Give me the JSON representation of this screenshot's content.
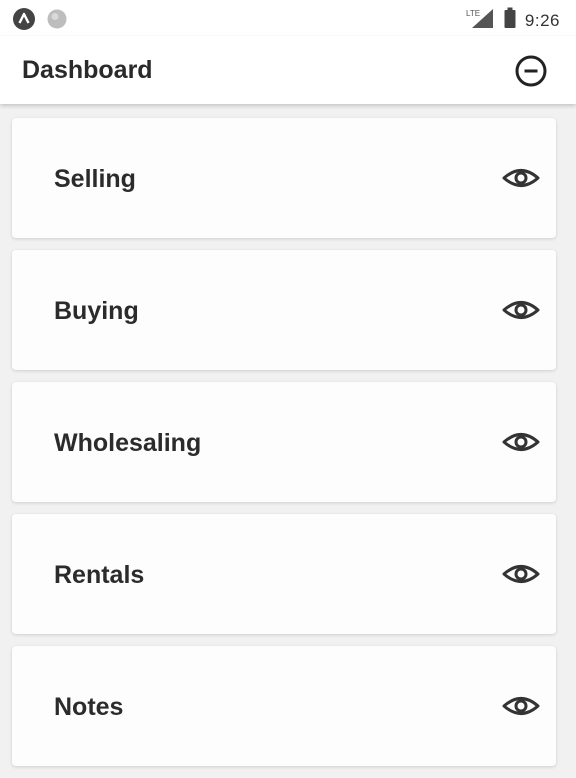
{
  "status_bar": {
    "time": "9:26",
    "network_label": "LTE",
    "icons": [
      "app-notification-icon",
      "dot-notification-icon",
      "lte-signal-icon",
      "battery-icon"
    ]
  },
  "app_bar": {
    "title": "Dashboard",
    "action_icon": "minus-circle-icon"
  },
  "cards": [
    {
      "label": "Selling",
      "icon": "eye-icon"
    },
    {
      "label": "Buying",
      "icon": "eye-icon"
    },
    {
      "label": "Wholesaling",
      "icon": "eye-icon"
    },
    {
      "label": "Rentals",
      "icon": "eye-icon"
    },
    {
      "label": "Notes",
      "icon": "eye-icon"
    }
  ],
  "colors": {
    "background": "#f1f1f1",
    "surface": "#ffffff",
    "text": "#2b2b2b",
    "icon": "#333333"
  }
}
